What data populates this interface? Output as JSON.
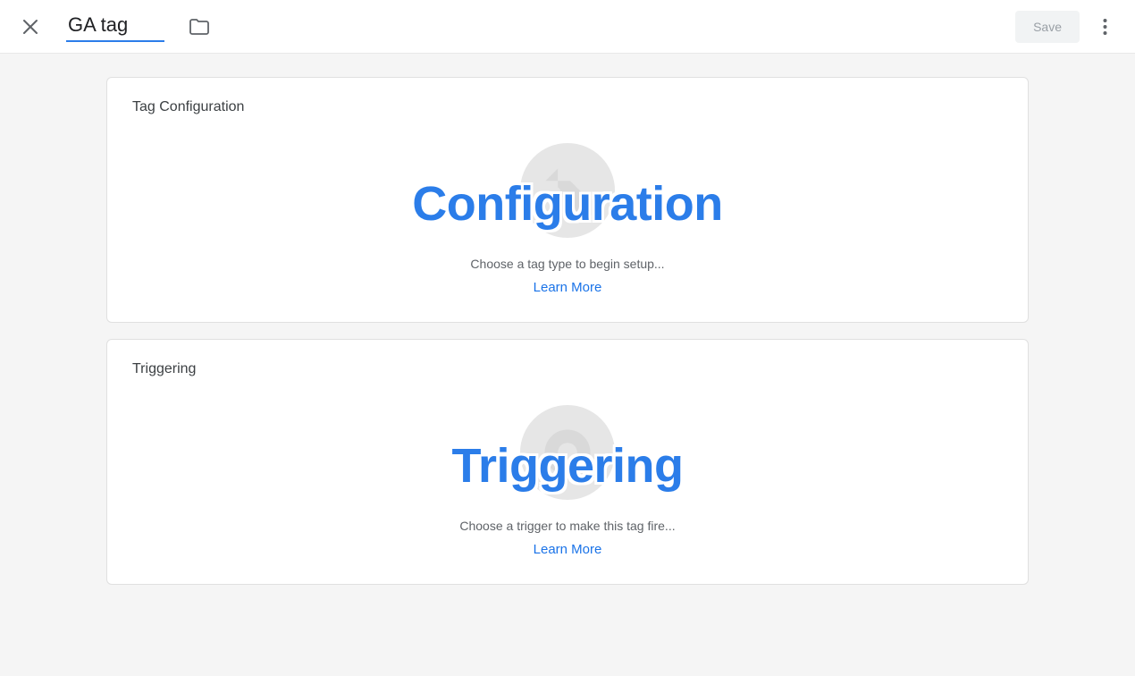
{
  "header": {
    "title_value": "GA tag",
    "save_label": "Save"
  },
  "cards": {
    "config": {
      "title": "Tag Configuration",
      "hint": "Choose a tag type to begin setup...",
      "learn_more": "Learn More",
      "overlay": "Configuration"
    },
    "trigger": {
      "title": "Triggering",
      "hint": "Choose a trigger to make this tag fire...",
      "learn_more": "Learn More",
      "overlay": "Triggering"
    }
  }
}
